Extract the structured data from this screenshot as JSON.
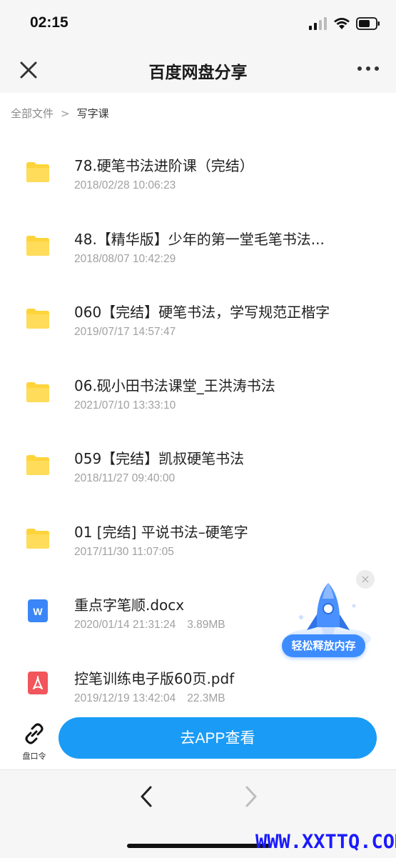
{
  "status": {
    "time": "02:15"
  },
  "nav": {
    "title": "百度网盘分享"
  },
  "breadcrumb": {
    "root": "全部文件",
    "separator": ">",
    "current": "写字课"
  },
  "files": [
    {
      "type": "folder",
      "icon": "folder-icon",
      "name": "78.硬笔书法进阶课（完结）",
      "date": "2018/02/28 10:06:23",
      "size": ""
    },
    {
      "type": "folder",
      "icon": "folder-icon",
      "name": "48.【精华版】少年的第一堂毛笔书法...",
      "date": "2018/08/07 10:42:29",
      "size": ""
    },
    {
      "type": "folder",
      "icon": "folder-icon",
      "name": "060【完结】硬笔书法，学写规范正楷字",
      "date": "2019/07/17 14:57:47",
      "size": ""
    },
    {
      "type": "folder",
      "icon": "folder-icon",
      "name": "06.砚小田书法课堂_王洪涛书法",
      "date": "2021/07/10 13:33:10",
      "size": ""
    },
    {
      "type": "folder",
      "icon": "folder-icon",
      "name": "059【完结】凯叔硬笔书法",
      "date": "2018/11/27 09:40:00",
      "size": ""
    },
    {
      "type": "folder",
      "icon": "folder-icon",
      "name": "01 [完结] 平说书法–硬笔字",
      "date": "2017/11/30 11:07:05",
      "size": ""
    },
    {
      "type": "docx",
      "icon": "word-doc-icon",
      "name": "重点字笔顺.docx",
      "date": "2020/01/14 21:31:24",
      "size": "3.89MB"
    },
    {
      "type": "pdf",
      "icon": "pdf-icon",
      "name": "控笔训练电子版60页.pdf",
      "date": "2019/12/19 13:42:04",
      "size": "22.3MB"
    }
  ],
  "promo": {
    "label": "轻松释放内存",
    "close": "×"
  },
  "bottom": {
    "link_code_label": "盘口令",
    "app_button": "去APP查看"
  },
  "watermark": "WWW.XXTTQ.COM",
  "colors": {
    "accent": "#1a9cf6",
    "folder": "#ffd43b",
    "word": "#3a86f6",
    "pdf": "#f0565b",
    "promo": "#3d8cff"
  }
}
